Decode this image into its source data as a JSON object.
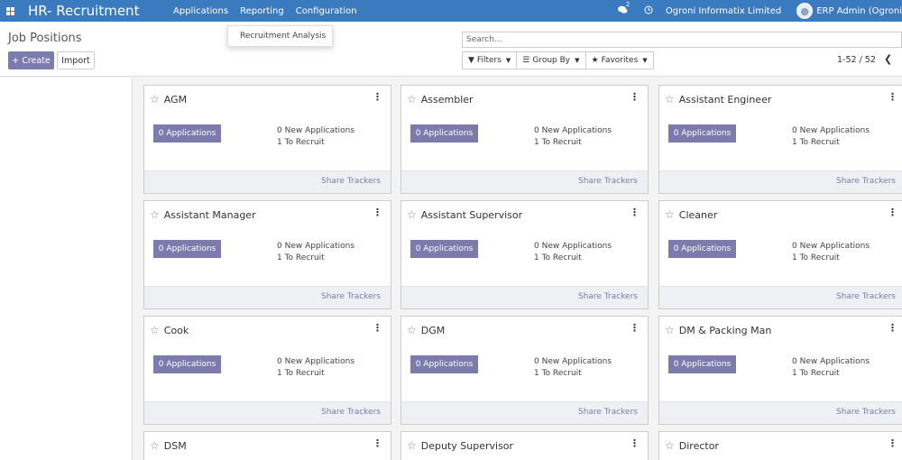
{
  "navbar": {
    "apps_icon": "grid-icon",
    "brand": "HR- Recruitment",
    "menu": [
      "Applications",
      "Reporting",
      "Configuration"
    ],
    "chat_icon": "chat-icon",
    "chat_badge": "2",
    "clock_icon": "clock-icon",
    "company": "Ogroni Informatix Limited",
    "user": "ERP Admin (Ogroni"
  },
  "dropdown": {
    "item": "Recruitment Analysis"
  },
  "control": {
    "title": "Job Positions",
    "create_label": "+ Create",
    "import_label": "Import",
    "search_placeholder": "Search...",
    "filters_label": "Filters",
    "groupby_label": "Group By",
    "favorites_label": "Favorites",
    "pager": "1-52 / 52"
  },
  "cards": [
    {
      "title": "AGM",
      "apps": "0 Applications",
      "new": "0 New Applications",
      "recruit": "1 To Recruit",
      "share": "Share Trackers"
    },
    {
      "title": "Assembler",
      "apps": "0 Applications",
      "new": "0 New Applications",
      "recruit": "1 To Recruit",
      "share": "Share Trackers"
    },
    {
      "title": "Assistant Engineer",
      "apps": "0 Applications",
      "new": "0 New Applications",
      "recruit": "1 To Recruit",
      "share": "Share Trackers"
    },
    {
      "title": "Assistant Manager",
      "apps": "0 Applications",
      "new": "0 New Applications",
      "recruit": "1 To Recruit",
      "share": "Share Trackers"
    },
    {
      "title": "Assistant Supervisor",
      "apps": "0 Applications",
      "new": "0 New Applications",
      "recruit": "1 To Recruit",
      "share": "Share Trackers"
    },
    {
      "title": "Cleaner",
      "apps": "0 Applications",
      "new": "0 New Applications",
      "recruit": "1 To Recruit",
      "share": "Share Trackers"
    },
    {
      "title": "Cook",
      "apps": "0 Applications",
      "new": "0 New Applications",
      "recruit": "1 To Recruit",
      "share": "Share Trackers"
    },
    {
      "title": "DGM",
      "apps": "0 Applications",
      "new": "0 New Applications",
      "recruit": "1 To Recruit",
      "share": "Share Trackers"
    },
    {
      "title": "DM & Packing Man",
      "apps": "0 Applications",
      "new": "0 New Applications",
      "recruit": "1 To Recruit",
      "share": "Share Trackers"
    },
    {
      "title": "DSM"
    },
    {
      "title": "Deputy Supervisor"
    },
    {
      "title": "Director"
    }
  ]
}
